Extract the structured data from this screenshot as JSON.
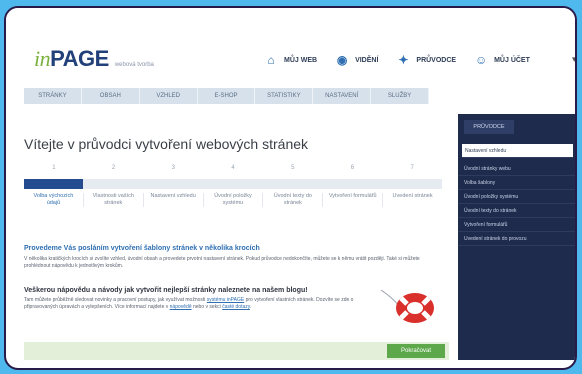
{
  "header": {
    "logo_prefix": "in",
    "logo_main": "PAGE",
    "logo_sub": "webová tvorba",
    "nav": [
      {
        "label": "MŮJ WEB",
        "icon": "home-icon"
      },
      {
        "label": "VIDĚNÍ",
        "icon": "eye-icon"
      },
      {
        "label": "PRŮVODCE",
        "icon": "wand-icon"
      },
      {
        "label": "MŮJ ÚČET",
        "icon": "user-icon"
      }
    ],
    "more": "▾"
  },
  "tabs": [
    "Stránky",
    "Obsah",
    "Vzhled",
    "E-shop",
    "Statistiky",
    "Nastavení",
    "Služby"
  ],
  "main": {
    "title": "Vítejte v průvodci vytvoření webových stránek",
    "progress_percent": 14,
    "step_numbers": [
      "1",
      "2",
      "3",
      "4",
      "5",
      "6",
      "7"
    ],
    "step_labels": [
      "Volba výchozích údajů",
      "Vlastnosti vaších stránek",
      "Nastavení vzhledu",
      "Úvodní položky systému",
      "Úvodní texty do stránek",
      "Vytvoření formulářů",
      "Uvedení stránek"
    ],
    "section1_heading": "Provedeme Vás posláním vytvoření šablony stránek v několika krocích",
    "section1_text": "V několika kratičkých krocích si zvolíte vzhled, úvodní obsah a provedete prvotní nastavení stránek. Pokud průvodce nedokončíte, můžete se k němu vrátit později. Také si můžete prohlédnout nápovědu k jednotlivým krokům.",
    "section2_heading": "Veškerou nápovědu a návody jak vytvořit nejlepší stránky naleznete na našem blogu!",
    "section2_text_1": "Tam můžete průběžně sledovat novinky a pracovní postupy, jak využívat možnosti ",
    "section2_link_1": "systému inPAGE",
    "section2_text_2": " pro vytvoření vlastních stránek. Dozvíte se zde o připravovaných úpravách a vylepšeních. Více informací najdete v ",
    "section2_link_2": "nápovědě",
    "section2_text_3": " nebo v sekci ",
    "section2_link_3": "časté dotazy",
    "section2_text_4": ".",
    "next_button": "Pokračovat"
  },
  "sidebar": {
    "heading": "Průvodce",
    "items": [
      {
        "label": "Nastavení vzhledu",
        "active": true
      },
      {
        "label": "Úvodní stránky webu",
        "active": false
      },
      {
        "label": "Volba šablony",
        "active": false
      },
      {
        "label": "Úvodní položky systému",
        "active": false
      },
      {
        "label": "Úvodní texty do stránek",
        "active": false
      },
      {
        "label": "Vytvoření formulářů",
        "active": false
      },
      {
        "label": "Uvedení stránek do provozu",
        "active": false
      }
    ]
  },
  "colors": {
    "background": "#4fb8ec",
    "brand_blue": "#22407a",
    "progress_fill": "#244a8f",
    "sidebar_bg": "#1f2b4d",
    "next_button": "#5ca84a",
    "buoy_red": "#d9302c"
  }
}
